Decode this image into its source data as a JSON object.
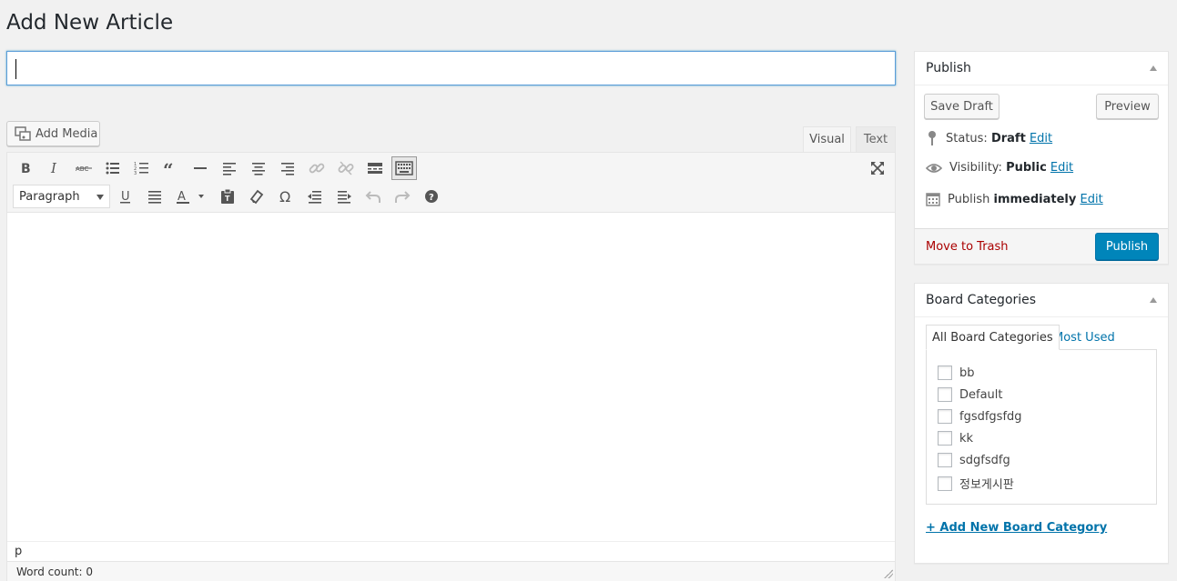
{
  "page": {
    "title": "Add New Article"
  },
  "title_input": {
    "value": ""
  },
  "editor": {
    "add_media_label": "Add Media",
    "tabs": {
      "visual": "Visual",
      "text": "Text",
      "active": "visual"
    },
    "format_select": "Paragraph",
    "path": "p",
    "word_count": "Word count: 0",
    "toolbar_row1": [
      "bold-icon",
      "italic-icon",
      "strikethrough-icon",
      "bullet-list-icon",
      "numbered-list-icon",
      "blockquote-icon",
      "horizontal-line-icon",
      "align-left-icon",
      "align-center-icon",
      "align-right-icon",
      "link-icon",
      "unlink-icon",
      "read-more-icon",
      "toolbar-toggle-icon"
    ],
    "toolbar_row2": [
      "underline-icon",
      "justify-icon",
      "text-color-icon",
      "paste-text-icon",
      "clear-formatting-icon",
      "special-character-icon",
      "outdent-icon",
      "indent-icon",
      "undo-icon",
      "redo-icon",
      "help-icon"
    ]
  },
  "publish": {
    "title": "Publish",
    "save_draft": "Save Draft",
    "preview": "Preview",
    "status_label": "Status:",
    "status_value": "Draft",
    "visibility_label": "Visibility:",
    "visibility_value": "Public",
    "publish_label": "Publish",
    "publish_value": "immediately",
    "edit": "Edit",
    "move_to_trash": "Move to Trash",
    "publish_button": "Publish",
    "accent_color": "#0085ba",
    "trash_color": "#a00"
  },
  "categories": {
    "title": "Board Categories",
    "tab_all": "All Board Categories",
    "tab_used": "Most Used",
    "items": [
      "bb",
      "Default",
      "fgsdfgsfdg",
      "kk",
      "sdgfsdfg",
      "정보게시판"
    ],
    "add_new": "+ Add New Board Category"
  }
}
